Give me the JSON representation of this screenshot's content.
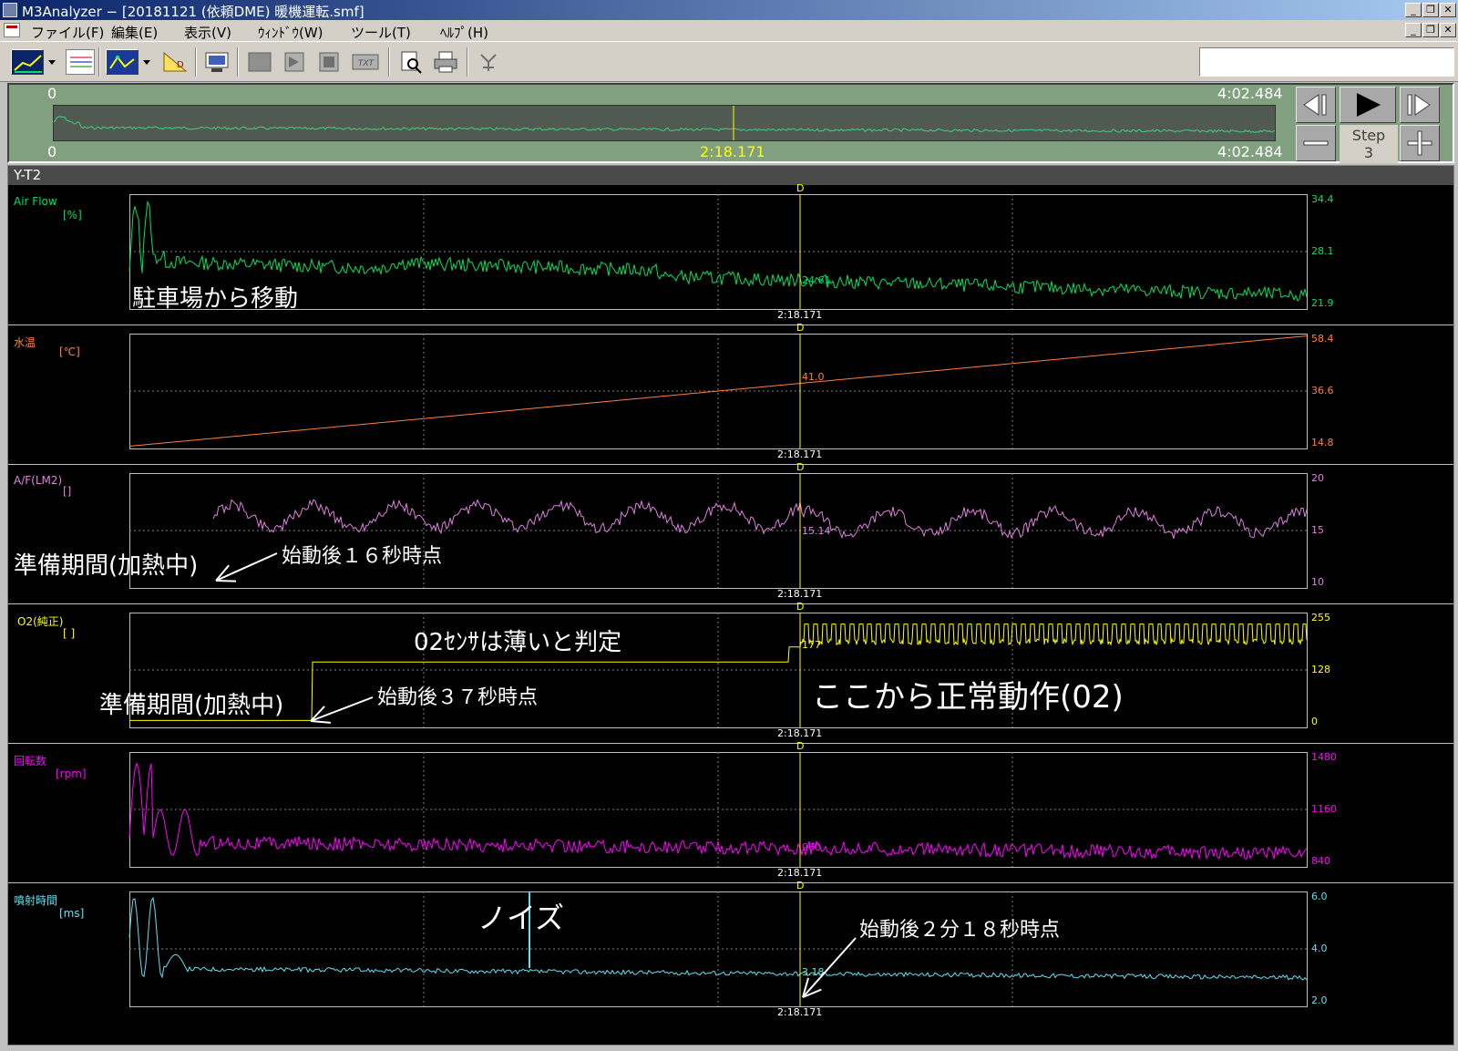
{
  "window": {
    "title": "M3Analyzer − [20181121 (依頼DME) 暖機運転.smf]",
    "min_btn": "_",
    "restore_btn": "❐",
    "close_btn": "✕"
  },
  "menu": [
    {
      "label": "ファイル(F)"
    },
    {
      "label": "編集(E)"
    },
    {
      "label": "表示(V)"
    },
    {
      "label": "ｳｨﾝﾄﾞｳ(W)"
    },
    {
      "label": "ツール(T)"
    },
    {
      "label": "ﾍﾙﾌﾟ(H)"
    }
  ],
  "overview": {
    "start_top": "0",
    "end_top": "4:02.484",
    "start_bottom": "0",
    "end_bottom": "4:02.484",
    "cursor_time": "2:18.171",
    "step_label": "Step",
    "step_value": "3"
  },
  "yt_title": "Y-T2",
  "cursor": {
    "marker": "D",
    "time": "2:18.171"
  },
  "channels": [
    {
      "name": "Air Flow",
      "unit": "[%]",
      "color": "#00e060",
      "ticks": [
        "34.4",
        "28.1",
        "21.9"
      ],
      "cursor_value": "24.61"
    },
    {
      "name": "水温",
      "unit": "[℃]",
      "color": "#ff8040",
      "ticks": [
        "58.4",
        "36.6",
        "14.8"
      ],
      "cursor_value": "41.0"
    },
    {
      "name": "A/F(LM2)",
      "unit": "[]",
      "color": "#e080e0",
      "ticks": [
        "20",
        "15",
        "10"
      ],
      "cursor_value": "15.14"
    },
    {
      "name": "O2(純正)",
      "unit": "[ ]",
      "color": "#ffff00",
      "ticks": [
        "255",
        "128",
        "0"
      ],
      "cursor_value": "177"
    },
    {
      "name": "回転数",
      "unit": "[rpm]",
      "color": "#ff00ff",
      "ticks": [
        "1480",
        "1160",
        "840"
      ],
      "cursor_value": "960"
    },
    {
      "name": "噴射時間",
      "unit": "[ms]",
      "color": "#60e0f0",
      "ticks": [
        "6.0",
        "4.0",
        "2.0"
      ],
      "cursor_value": "3.18"
    }
  ],
  "annotations": {
    "parking": "駐車場から移動",
    "prep1": "準備期間(加熱中)",
    "start16": "始動後１６秒時点",
    "o2lean": "02ｾﾝｻは薄いと判定",
    "prep2": "準備期間(加熱中)",
    "start37": "始動後３７秒時点",
    "normal": "ここから正常動作(02)",
    "noise": "ノイズ",
    "start218": "始動後２分１８秒時点"
  }
}
